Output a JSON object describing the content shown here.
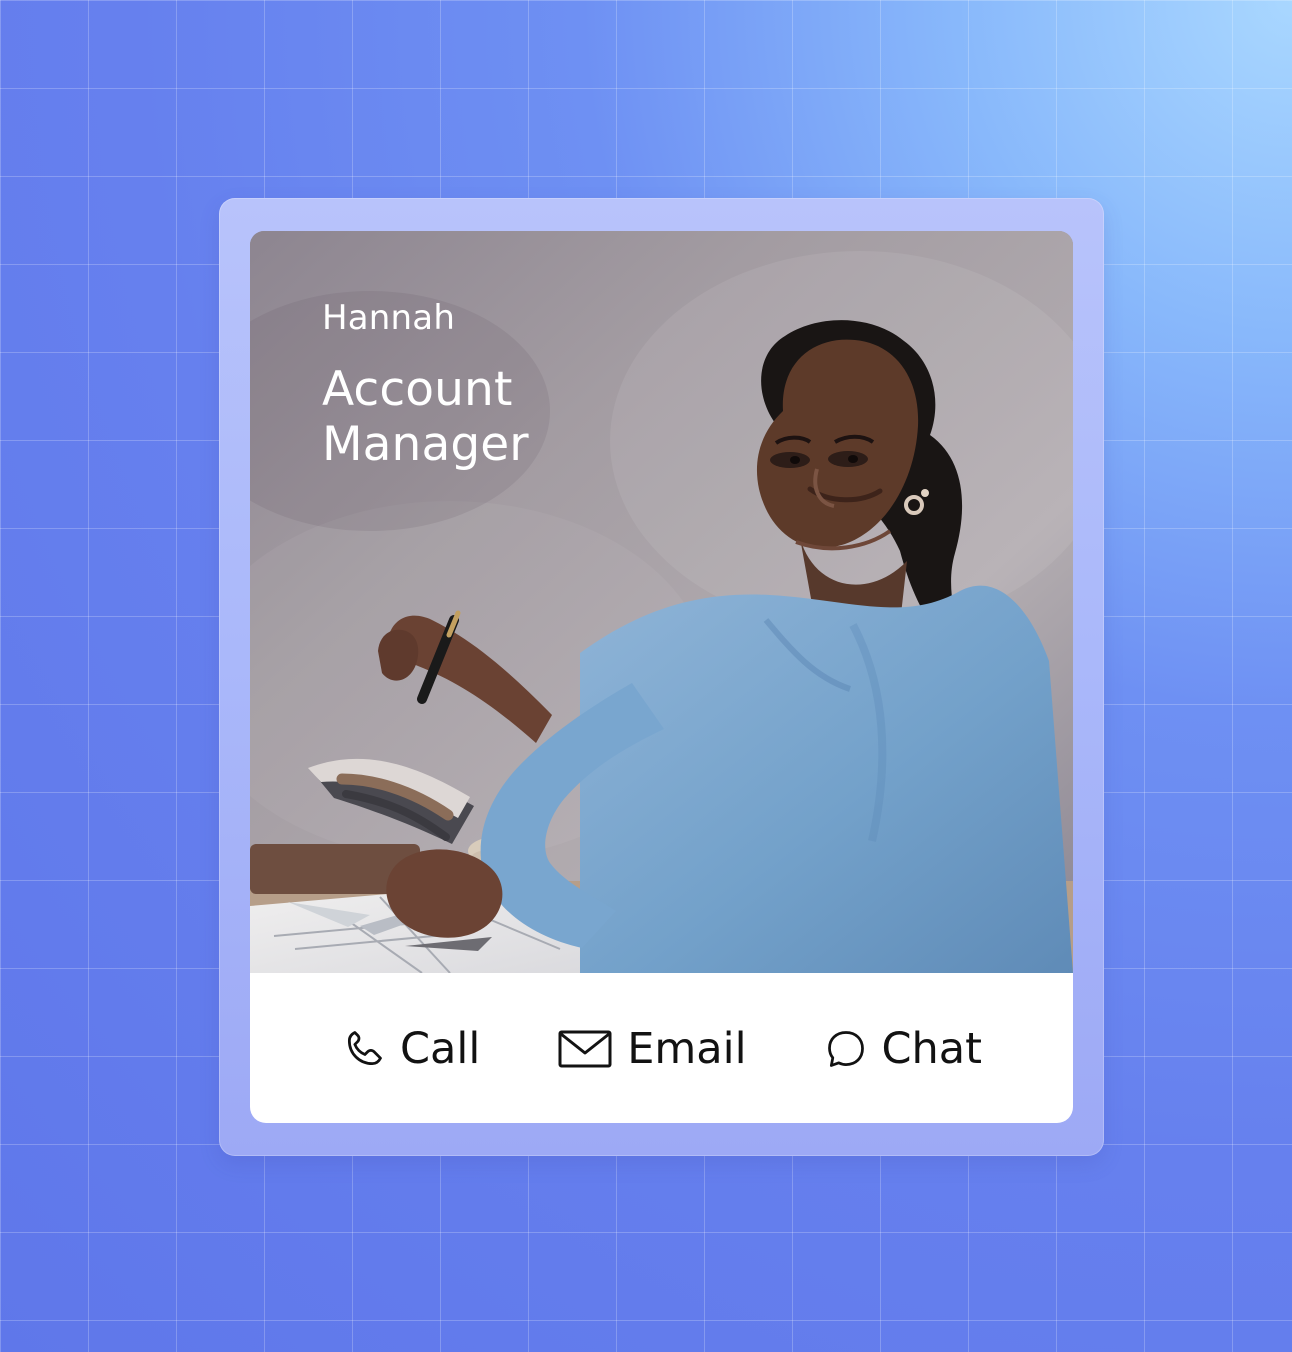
{
  "profile": {
    "name": "Hannah",
    "role": "Account Manager"
  },
  "actions": [
    {
      "label": "Call",
      "icon": "phone-icon"
    },
    {
      "label": "Email",
      "icon": "mail-icon"
    },
    {
      "label": "Chat",
      "icon": "chat-icon"
    }
  ],
  "colors": {
    "page_background_start": "#a9d7ff",
    "page_background_end": "#5f77ea",
    "card_frame": "#aab8fa",
    "action_panel": "#ffffff",
    "text_dark": "#121212",
    "text_light": "#ffffff"
  }
}
